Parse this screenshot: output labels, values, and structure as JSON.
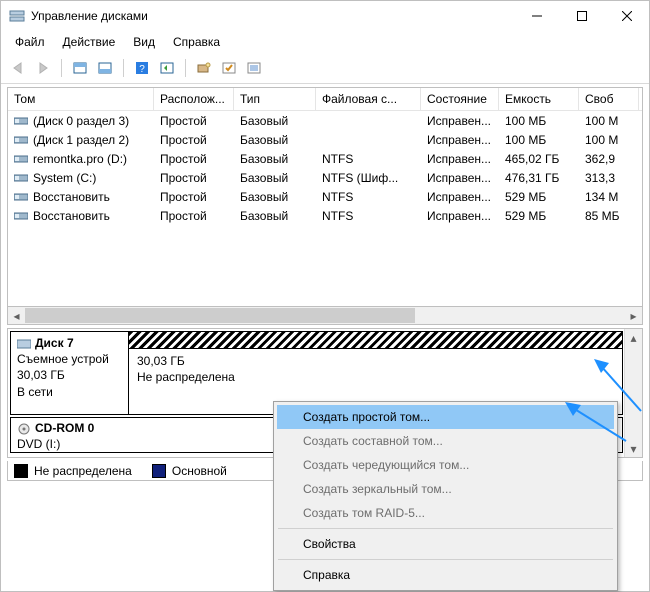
{
  "titlebar": {
    "title": "Управление дисками"
  },
  "menubar": [
    "Файл",
    "Действие",
    "Вид",
    "Справка"
  ],
  "volumes": {
    "columns": [
      "Том",
      "Располож...",
      "Тип",
      "Файловая с...",
      "Состояние",
      "Емкость",
      "Своб"
    ],
    "rows": [
      {
        "name": "(Диск 0 раздел 3)",
        "layout": "Простой",
        "type": "Базовый",
        "fs": "",
        "status": "Исправен...",
        "cap": "100 МБ",
        "free": "100 М"
      },
      {
        "name": "(Диск 1 раздел 2)",
        "layout": "Простой",
        "type": "Базовый",
        "fs": "",
        "status": "Исправен...",
        "cap": "100 МБ",
        "free": "100 М"
      },
      {
        "name": "remontka.pro (D:)",
        "layout": "Простой",
        "type": "Базовый",
        "fs": "NTFS",
        "status": "Исправен...",
        "cap": "465,02 ГБ",
        "free": "362,9"
      },
      {
        "name": "System (C:)",
        "layout": "Простой",
        "type": "Базовый",
        "fs": "NTFS (Шиф...",
        "status": "Исправен...",
        "cap": "476,31 ГБ",
        "free": "313,3"
      },
      {
        "name": "Восстановить",
        "layout": "Простой",
        "type": "Базовый",
        "fs": "NTFS",
        "status": "Исправен...",
        "cap": "529 МБ",
        "free": "134 М"
      },
      {
        "name": "Восстановить",
        "layout": "Простой",
        "type": "Базовый",
        "fs": "NTFS",
        "status": "Исправен...",
        "cap": "529 МБ",
        "free": "85 МБ"
      }
    ]
  },
  "disk": {
    "name": "Диск 7",
    "kind": "Съемное устрой",
    "size": "30,03 ГБ",
    "online": "В сети",
    "part": {
      "size": "30,03 ГБ",
      "state": "Не распределена"
    }
  },
  "cdrom": {
    "name": "CD-ROM 0",
    "drive": "DVD (I:)"
  },
  "legend": {
    "unalloc": "Не распределена",
    "primary": "Основной"
  },
  "context_menu": {
    "items": [
      {
        "label": "Создать простой том...",
        "enabled": true,
        "highlight": true
      },
      {
        "label": "Создать составной том...",
        "enabled": false,
        "highlight": false
      },
      {
        "label": "Создать чередующийся том...",
        "enabled": false,
        "highlight": false
      },
      {
        "label": "Создать зеркальный том...",
        "enabled": false,
        "highlight": false
      },
      {
        "label": "Создать том RAID-5...",
        "enabled": false,
        "highlight": false
      }
    ],
    "properties": "Свойства",
    "help": "Справка"
  }
}
